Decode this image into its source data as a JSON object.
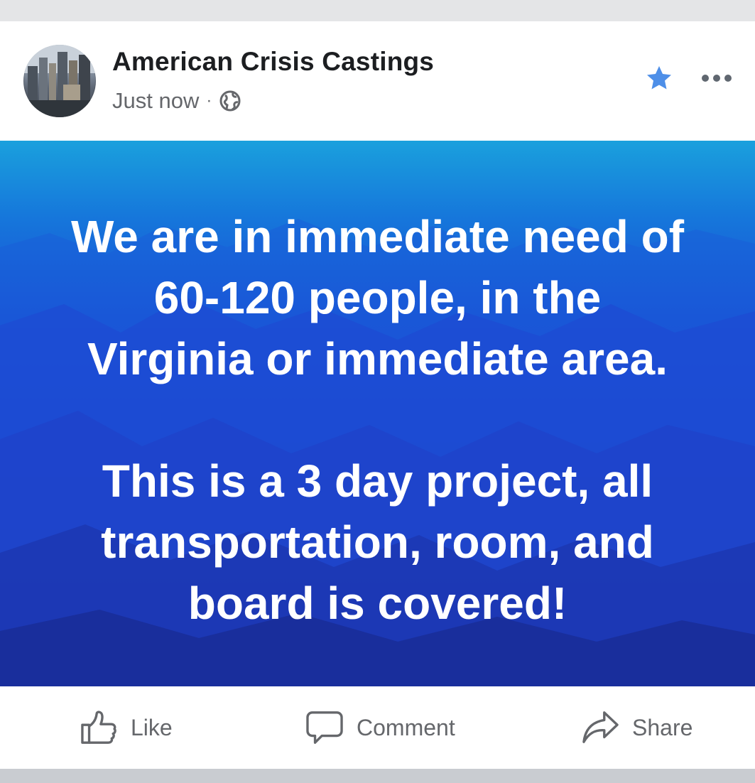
{
  "post": {
    "page_name": "American Crisis Castings",
    "timestamp": "Just now",
    "separator": "·",
    "privacy_icon": "globe-icon",
    "favorite_icon": "star-icon",
    "more_icon": "more-dots-icon",
    "banner": {
      "paragraph_1": [
        "We are in immediate need of",
        "60-120 people, in the",
        "Virginia or immediate area."
      ],
      "paragraph_2": [
        "This is a 3 day project, all",
        "transportation, room, and",
        "board is covered!"
      ]
    }
  },
  "actions": {
    "like": {
      "label": "Like",
      "icon": "thumbs-up-icon"
    },
    "comment": {
      "label": "Comment",
      "icon": "speech-bubble-icon"
    },
    "share": {
      "label": "Share",
      "icon": "share-arrow-icon"
    }
  },
  "colors": {
    "accent_blue": "#4e8fe8",
    "text_primary": "#1c1e21",
    "text_secondary": "#65676b",
    "banner_top": "#1aa0dd",
    "banner_bottom": "#162a93"
  }
}
